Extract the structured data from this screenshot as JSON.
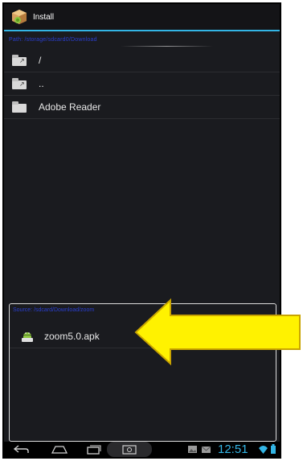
{
  "app": {
    "title": "Install",
    "icon": "install-package-icon"
  },
  "path_bar": {
    "text": "Path: /storage/sdcard0/Download"
  },
  "file_list": [
    {
      "label": "/",
      "icon": "folder-up-icon"
    },
    {
      "label": "..",
      "icon": "folder-up-icon"
    },
    {
      "label": "Adobe Reader",
      "icon": "folder-icon"
    }
  ],
  "lower_panel": {
    "path_text": "Source: /sdcard/Download/zoom",
    "items": [
      {
        "label": "zoom5.0.apk",
        "icon": "apk-android-icon"
      }
    ]
  },
  "status_bar": {
    "clock": "12:51",
    "icons": [
      "back-icon",
      "home-icon",
      "recent-apps-icon",
      "screenshot-icon",
      "gallery-notification-icon",
      "email-notification-icon",
      "wifi-icon",
      "battery-icon"
    ]
  },
  "colors": {
    "accent": "#33b5e5",
    "arrow_fill": "#fff200",
    "arrow_stroke": "#c9a400",
    "path_text": "#2a3fd0"
  }
}
